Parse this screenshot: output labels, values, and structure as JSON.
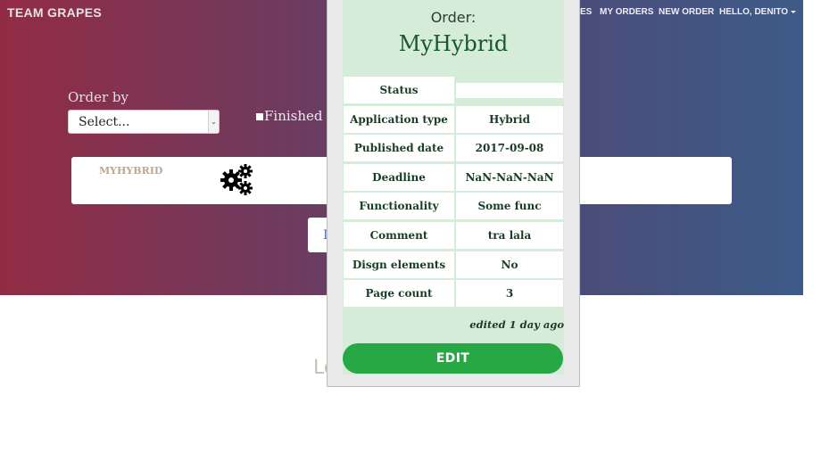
{
  "brand": "TEAM GRAPES",
  "nav": {
    "partial_item": "ES",
    "my_orders": "MY ORDERS",
    "new_order": "NEW ORDER",
    "user": "HELLO, DENITO"
  },
  "filters": {
    "order_by_label": "Order by",
    "order_by_selected": "Select...",
    "finished_label": "Finished"
  },
  "order_card": {
    "title": "MYHYBRID",
    "icon": "gears-icon"
  },
  "partial_button_letter": "L",
  "background_text": "Lo",
  "modal": {
    "heading": "Order:",
    "name": "MyHybrid",
    "rows": [
      {
        "label": "Status",
        "value": ""
      },
      {
        "label": "Application type",
        "value": "Hybrid"
      },
      {
        "label": "Published date",
        "value": "2017-09-08"
      },
      {
        "label": "Deadline",
        "value": "NaN-NaN-NaN"
      },
      {
        "label": "Functionality",
        "value": "Some func"
      },
      {
        "label": "Comment",
        "value": "tra lala"
      },
      {
        "label": "Disgn elements",
        "value": "No"
      },
      {
        "label": "Page count",
        "value": "3"
      }
    ],
    "edited": "edited 1 day ago",
    "edit_button": "EDIT"
  },
  "colors": {
    "gradient_start": "#922b44",
    "gradient_end": "#3d5b88",
    "edit_button": "#28a745",
    "modal_bg": "#d5ecd9"
  }
}
